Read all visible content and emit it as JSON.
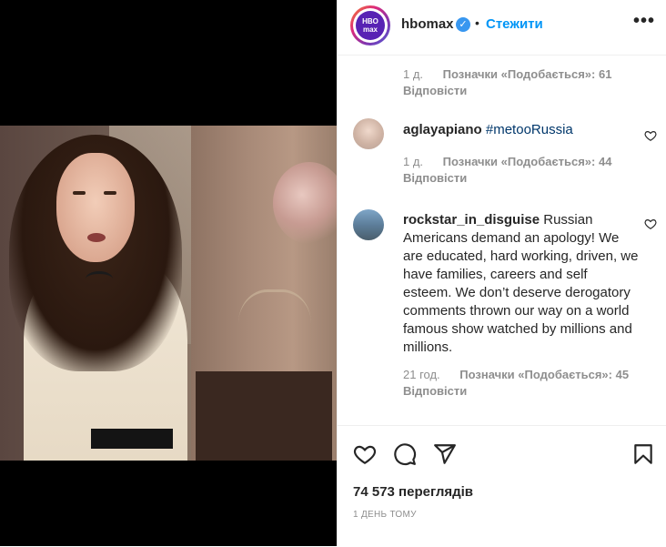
{
  "post": {
    "account": "hbomax",
    "avatar_text": "HBO max",
    "verified": true,
    "dot": "•",
    "follow_label": "Стежити",
    "more_label": "•••"
  },
  "comments": [
    {
      "time": "1 д.",
      "likes": "Позначки «Подобається»: 61",
      "reply": "Відповісти"
    },
    {
      "user": "aglayapiano",
      "text": "#metooRussia",
      "time": "1 д.",
      "likes": "Позначки «Подобається»: 44",
      "reply": "Відповісти"
    },
    {
      "user": "rockstar_in_disguise",
      "text": "Russian Americans demand an apology! We are educated, hard working, driven, we have families, careers and self esteem. We don’t deserve derogatory comments thrown our way on a world famous show watched by millions and millions.",
      "time": "21 год.",
      "likes": "Позначки «Подобається»: 45",
      "reply": "Відповісти"
    }
  ],
  "stats": {
    "views": "74 573 переглядів",
    "posted": "1 ДЕНЬ ТОМУ"
  },
  "icons": [
    "heart-icon",
    "comment-icon",
    "share-icon",
    "bookmark-icon",
    "verified-badge-icon",
    "more-options-icon"
  ],
  "colors": {
    "accent": "#0095f6",
    "text": "#262626",
    "muted": "#8e8e8e",
    "hbo_purple": "#5822b4",
    "verified": "#3897f0"
  }
}
